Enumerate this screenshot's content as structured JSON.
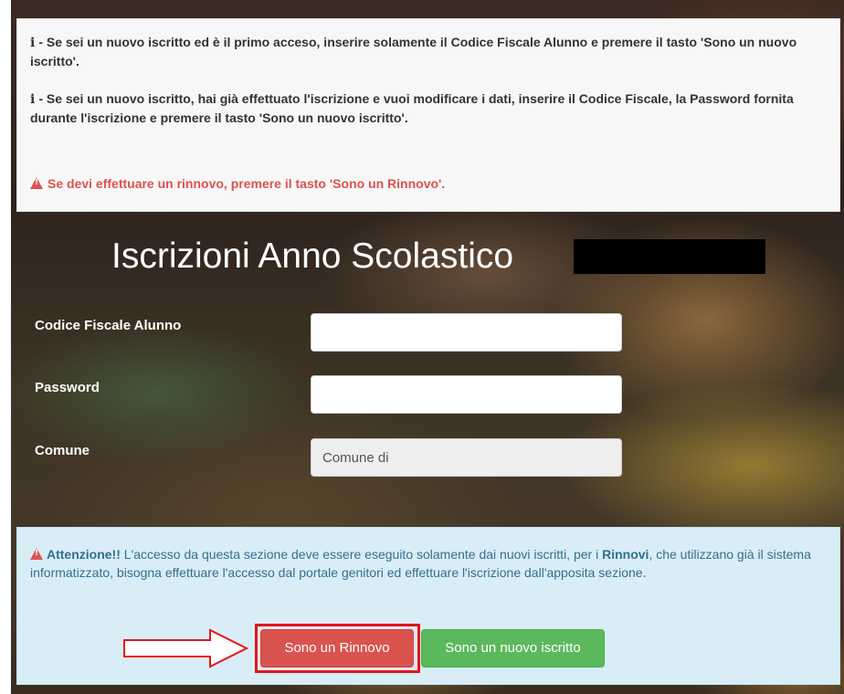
{
  "info_panel": {
    "line1": "- Se sei un nuovo iscritto ed è il primo acceso, inserire solamente il Codice Fiscale Alunno e premere il tasto 'Sono un nuovo iscritto'.",
    "line2": "- Se sei un nuovo iscritto, hai già effettuato l'iscrizione e vuoi modificare i dati, inserire il Codice Fiscale, la Password fornita durante l'iscrizione e premere il tasto 'Sono un nuovo iscritto'.",
    "info_icon": "i",
    "warning": "Se devi effettuare un rinnovo, premere il tasto 'Sono un Rinnovo'.",
    "warning_color": "#d9534f"
  },
  "page_title": "Iscrizioni Anno Scolastico",
  "form": {
    "codice_fiscale_label": "Codice Fiscale Alunno",
    "codice_fiscale_value": "",
    "password_label": "Password",
    "password_value": "",
    "comune_label": "Comune",
    "comune_value": "Comune di"
  },
  "alert": {
    "attention": "Attenzione!!",
    "text1": " L'accesso da questa sezione deve essere eseguito solamente dai nuovi iscritti, per i ",
    "rinnovi": "Rinnovi",
    "text2": ", che utilizzano già il sistema informatizzato, bisogna effettuare l'accesso dal portale genitori ed effettuare l'iscrizione dall'apposita sezione."
  },
  "buttons": {
    "rinnovo_label": "Sono un Rinnovo",
    "nuovo_label": "Sono un nuovo iscritto",
    "rinnovo_color": "#d9534f",
    "nuovo_color": "#5cb85c"
  },
  "annotation": {
    "highlight_color": "#e8141a",
    "arrow_icon": "right-arrow-icon"
  }
}
